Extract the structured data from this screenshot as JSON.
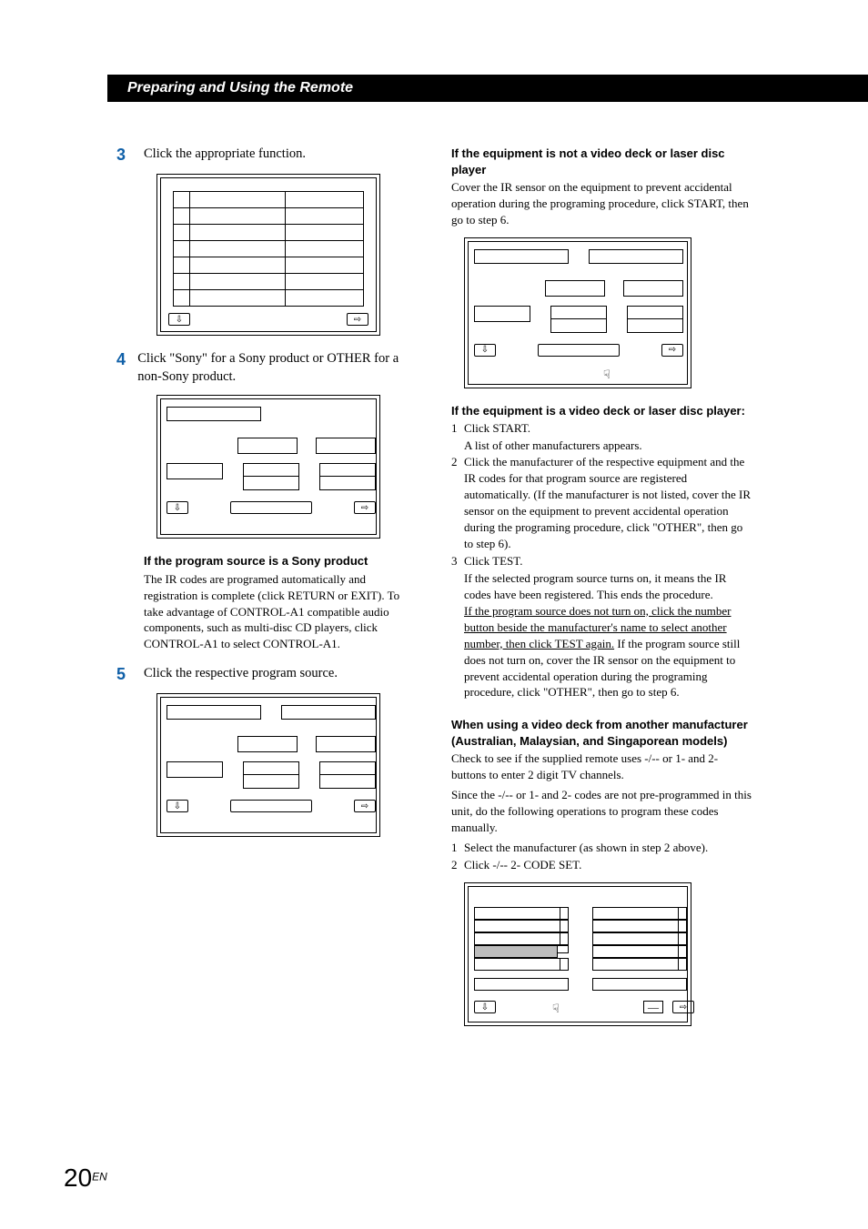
{
  "page_number": "20",
  "page_lang": "EN",
  "section_bar_title": "Preparing and Using the Remote",
  "left": {
    "step3": {
      "num": "3",
      "text": "Click the appropriate function."
    },
    "step4": {
      "num": "4",
      "text": "Click \"Sony\" for a Sony product or OTHER for a non-Sony product."
    },
    "sony_heading": "If the program source is a Sony product",
    "sony_para": "The IR codes are programed automatically and registration is complete (click RETURN or EXIT). To take advantage of CONTROL-A1 compatible audio components, such as multi-disc CD players, click CONTROL-A1 to select CONTROL-A1.",
    "step5": {
      "num": "5",
      "text": "Click the respective program source."
    }
  },
  "right": {
    "nonvideo_heading": "If the equipment is not a video deck or laser disc player",
    "nonvideo_para": "Cover the IR sensor on the equipment to prevent accidental operation during the programing procedure, click START, then go to step 6.",
    "video_heading": "If the equipment is a video deck or laser disc player:",
    "video_list": {
      "i1n": "1",
      "i1t": "Click START.",
      "i1_sub": "A list of other manufacturers appears.",
      "i2n": "2",
      "i2t": "Click the manufacturer of the respective equipment and the IR codes for that program source are registered automatically. (If the manufacturer is not listed, cover the IR sensor on the equipment to prevent accidental operation during the programing procedure, click \"OTHER\", then go to step 6).",
      "i3n": "3",
      "i3t": "Click TEST.",
      "i3_sub1": "If the selected program source turns on, it means the IR codes have been registered. This ends the procedure.",
      "i3_sub2_u": "If the program source does not turn on, click the number button beside the manufacturer's name  to select another number, then click TEST again.",
      "i3_sub2_rest": " If the program source still does not turn on, cover the IR sensor on the equipment to prevent accidental operation during the programing procedure, click \"OTHER\", then go to step 6."
    },
    "aus_heading": "When using a video deck from another manufacturer (Australian, Malaysian, and Singaporean models)",
    "aus_para1": "Check to see if the supplied remote uses -/-- or 1- and 2- buttons to enter 2 digit TV channels.",
    "aus_para2": "Since the -/-- or 1- and 2- codes are not pre-programmed in this unit, do the following operations to program these codes manually.",
    "aus_list": {
      "i1n": "1",
      "i1t": "Select the manufacturer (as shown in step 2 above).",
      "i2n": "2",
      "i2t": "Click -/--  2-  CODE SET."
    }
  },
  "icons": {
    "return": "⇩",
    "next": "⇨",
    "minus": "—",
    "cursor": "☟"
  }
}
